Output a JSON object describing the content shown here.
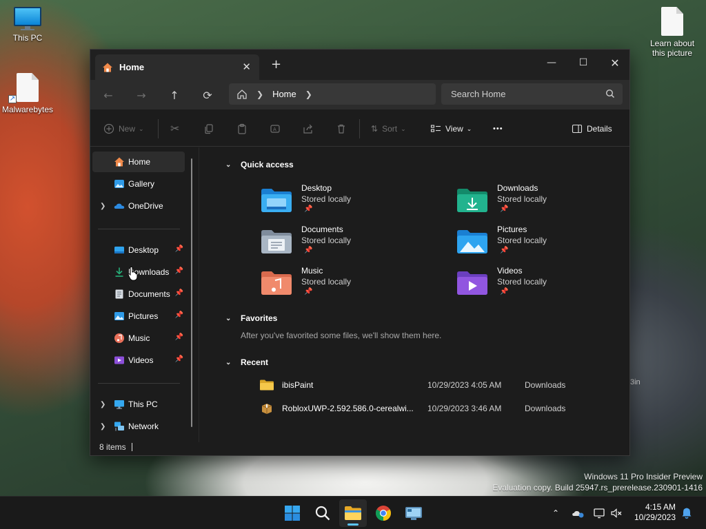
{
  "desktop": {
    "icons": [
      {
        "label": "This PC",
        "icon": "this-pc-icon"
      },
      {
        "label": "Malwarebytes",
        "icon": "file-shortcut-icon"
      },
      {
        "label": "Learn about this picture",
        "icon": "file-icon"
      }
    ],
    "bg_fragment": "3in",
    "watermark": {
      "line1": "Windows 11 Pro Insider Preview",
      "line2": "Evaluation copy. Build 25947.rs_prerelease.230901-1416"
    }
  },
  "window": {
    "tab": {
      "label": "Home",
      "close": "✕"
    },
    "new_tab": "+",
    "controls": {
      "minimize": "—",
      "maximize": "☐",
      "close": "✕"
    },
    "address": {
      "crumb": "Home"
    },
    "search": {
      "placeholder": "Search Home"
    },
    "commands": {
      "new": "New",
      "sort": "Sort",
      "view": "View",
      "more": "•••",
      "details": "Details"
    },
    "sidebar": {
      "items": [
        {
          "label": "Home",
          "icon": "home-icon",
          "selected": true
        },
        {
          "label": "Gallery",
          "icon": "gallery-icon"
        },
        {
          "label": "OneDrive",
          "icon": "onedrive-icon",
          "expandable": true
        }
      ],
      "pinned": [
        {
          "label": "Desktop",
          "icon": "desktop-folder-icon"
        },
        {
          "label": "Downloads",
          "icon": "downloads-icon"
        },
        {
          "label": "Documents",
          "icon": "documents-icon"
        },
        {
          "label": "Pictures",
          "icon": "pictures-icon"
        },
        {
          "label": "Music",
          "icon": "music-icon"
        },
        {
          "label": "Videos",
          "icon": "videos-icon"
        }
      ],
      "bottom": [
        {
          "label": "This PC",
          "icon": "this-pc-icon"
        },
        {
          "label": "Network",
          "icon": "network-icon"
        }
      ]
    },
    "sections": {
      "quick_access": "Quick access",
      "favorites": "Favorites",
      "recent": "Recent"
    },
    "quick_access": [
      {
        "name": "Desktop",
        "sub": "Stored locally",
        "icon": "desktop-folder-icon"
      },
      {
        "name": "Downloads",
        "sub": "Stored locally",
        "icon": "downloads-folder-icon"
      },
      {
        "name": "Documents",
        "sub": "Stored locally",
        "icon": "documents-folder-icon"
      },
      {
        "name": "Pictures",
        "sub": "Stored locally",
        "icon": "pictures-folder-icon"
      },
      {
        "name": "Music",
        "sub": "Stored locally",
        "icon": "music-folder-icon"
      },
      {
        "name": "Videos",
        "sub": "Stored locally",
        "icon": "videos-folder-icon"
      }
    ],
    "favorites_note": "After you've favorited some files, we'll show them here.",
    "recent": [
      {
        "name": "ibisPaint",
        "date": "10/29/2023 4:05 AM",
        "location": "Downloads",
        "icon": "folder-icon"
      },
      {
        "name": "RobloxUWP-2.592.586.0-cerealwi...",
        "date": "10/29/2023 3:46 AM",
        "location": "Downloads",
        "icon": "package-icon"
      }
    ],
    "status": {
      "count": "8 items"
    }
  },
  "taskbar": {
    "apps": [
      "start-icon",
      "search-icon",
      "file-explorer-icon",
      "chrome-icon",
      "remote-desktop-icon"
    ],
    "clock": {
      "time": "4:15 AM",
      "date": "10/29/2023"
    }
  }
}
